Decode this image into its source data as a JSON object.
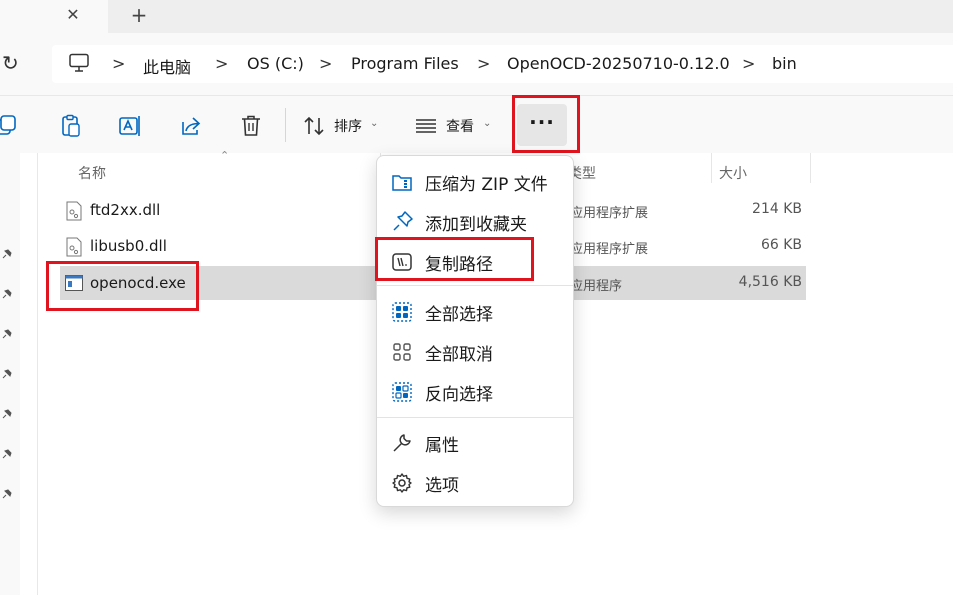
{
  "tabs": {
    "close_glyph": "✕",
    "new_tab_glyph": "+"
  },
  "address": {
    "refresh_glyph": "↻",
    "crumbs": [
      "此电脑",
      "OS (C:)",
      "Program Files",
      "OpenOCD-20250710-0.12.0",
      "bin"
    ],
    "separator": ">"
  },
  "toolbar": {
    "sort_label": "排序",
    "view_label": "查看",
    "more_label": "···",
    "chevron": "⌄"
  },
  "columns": {
    "name": "名称",
    "type": "类型",
    "size": "大小"
  },
  "files": [
    {
      "name": "ftd2xx.dll",
      "type": "应用程序扩展",
      "size": "214 KB"
    },
    {
      "name": "libusb0.dll",
      "type": "应用程序扩展",
      "size": "66 KB"
    },
    {
      "name": "openocd.exe",
      "type": "应用程序",
      "size": "4,516 KB"
    }
  ],
  "menu": {
    "items": [
      {
        "label": "压缩为 ZIP 文件",
        "icon": "zip-folder-icon"
      },
      {
        "label": "添加到收藏夹",
        "icon": "pin-icon"
      },
      {
        "label": "复制路径",
        "icon": "copy-path-icon"
      },
      {
        "label": "全部选择",
        "icon": "select-all-icon"
      },
      {
        "label": "全部取消",
        "icon": "select-none-icon"
      },
      {
        "label": "反向选择",
        "icon": "invert-selection-icon"
      },
      {
        "label": "属性",
        "icon": "wrench-icon"
      },
      {
        "label": "选项",
        "icon": "gear-icon"
      }
    ]
  },
  "colors": {
    "highlight": "#e0141e",
    "accent": "#0067c0",
    "selected_row": "#dadada"
  }
}
